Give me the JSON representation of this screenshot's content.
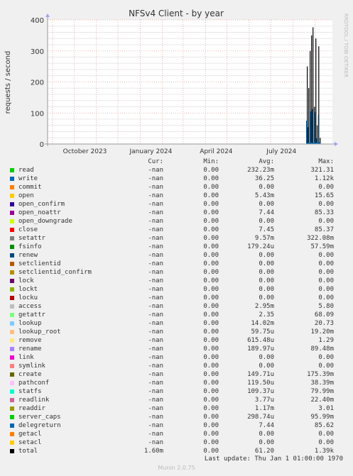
{
  "chart_data": {
    "type": "line",
    "title": "NFSv4 Client - by year",
    "ylabel": "requests / second",
    "side_label": "RRDTOOL / TOBI OETIKER",
    "ylim": [
      0,
      400
    ],
    "yticks": [
      0,
      100,
      200,
      300,
      400
    ],
    "xticks": [
      "October 2023",
      "January 2024",
      "April 2024",
      "July 2024"
    ],
    "grid": true,
    "spikes": {
      "x": [
        "2024-08-21",
        "2024-08-23",
        "2024-08-25",
        "2024-08-27",
        "2024-08-29",
        "2024-08-31",
        "2024-09-02",
        "2024-09-04",
        "2024-09-06",
        "2024-09-08"
      ],
      "total": [
        250,
        180,
        300,
        350,
        376,
        120,
        340,
        60,
        315,
        20
      ]
    },
    "colors": {
      "background": "#f0f0f0",
      "plot_bg": "#ffffff",
      "grid_major": "#e0a0a0",
      "grid_minor": "#e8e8e8",
      "axis": "#999999",
      "total": "#000000"
    }
  },
  "legend": {
    "headers": {
      "cur": "Cur:",
      "min": "Min:",
      "avg": "Avg:",
      "max": "Max:"
    },
    "rows": [
      {
        "name": "read",
        "color": "#00cc00",
        "cur": "-nan",
        "min": "0.00",
        "avg": "232.23m",
        "max": "321.31"
      },
      {
        "name": "write",
        "color": "#0066b3",
        "cur": "-nan",
        "min": "0.00",
        "avg": "36.25",
        "max": "1.12k"
      },
      {
        "name": "commit",
        "color": "#ff8000",
        "cur": "-nan",
        "min": "0.00",
        "avg": "0.00",
        "max": "0.00"
      },
      {
        "name": "open",
        "color": "#ffcc00",
        "cur": "-nan",
        "min": "0.00",
        "avg": "5.43m",
        "max": "15.65"
      },
      {
        "name": "open_confirm",
        "color": "#330099",
        "cur": "-nan",
        "min": "0.00",
        "avg": "0.00",
        "max": "0.00"
      },
      {
        "name": "open_noattr",
        "color": "#990099",
        "cur": "-nan",
        "min": "0.00",
        "avg": "7.44",
        "max": "85.33"
      },
      {
        "name": "open_downgrade",
        "color": "#ccff00",
        "cur": "-nan",
        "min": "0.00",
        "avg": "0.00",
        "max": "0.00"
      },
      {
        "name": "close",
        "color": "#ff0000",
        "cur": "-nan",
        "min": "0.00",
        "avg": "7.45",
        "max": "85.37"
      },
      {
        "name": "setattr",
        "color": "#808080",
        "cur": "-nan",
        "min": "0.00",
        "avg": "9.57m",
        "max": "322.08m"
      },
      {
        "name": "fsinfo",
        "color": "#008f00",
        "cur": "-nan",
        "min": "0.00",
        "avg": "179.24u",
        "max": "57.59m"
      },
      {
        "name": "renew",
        "color": "#00487d",
        "cur": "-nan",
        "min": "0.00",
        "avg": "0.00",
        "max": "0.00"
      },
      {
        "name": "setclientid",
        "color": "#b35a00",
        "cur": "-nan",
        "min": "0.00",
        "avg": "0.00",
        "max": "0.00"
      },
      {
        "name": "setclientid_confirm",
        "color": "#b38f00",
        "cur": "-nan",
        "min": "0.00",
        "avg": "0.00",
        "max": "0.00"
      },
      {
        "name": "lock",
        "color": "#6b006b",
        "cur": "-nan",
        "min": "0.00",
        "avg": "0.00",
        "max": "0.00"
      },
      {
        "name": "lockt",
        "color": "#8fb300",
        "cur": "-nan",
        "min": "0.00",
        "avg": "0.00",
        "max": "0.00"
      },
      {
        "name": "locku",
        "color": "#b30000",
        "cur": "-nan",
        "min": "0.00",
        "avg": "0.00",
        "max": "0.00"
      },
      {
        "name": "access",
        "color": "#bebebe",
        "cur": "-nan",
        "min": "0.00",
        "avg": "2.95m",
        "max": "5.80"
      },
      {
        "name": "getattr",
        "color": "#80ff80",
        "cur": "-nan",
        "min": "0.00",
        "avg": "2.35",
        "max": "68.09"
      },
      {
        "name": "lookup",
        "color": "#80c9ff",
        "cur": "-nan",
        "min": "0.00",
        "avg": "14.02m",
        "max": "20.73"
      },
      {
        "name": "lookup_root",
        "color": "#ffc080",
        "cur": "-nan",
        "min": "0.00",
        "avg": "59.75u",
        "max": "19.20m"
      },
      {
        "name": "remove",
        "color": "#ffe680",
        "cur": "-nan",
        "min": "0.00",
        "avg": "615.48u",
        "max": "1.29"
      },
      {
        "name": "rename",
        "color": "#aa80ff",
        "cur": "-nan",
        "min": "0.00",
        "avg": "189.97u",
        "max": "89.48m"
      },
      {
        "name": "link",
        "color": "#ee00cc",
        "cur": "-nan",
        "min": "0.00",
        "avg": "0.00",
        "max": "0.00"
      },
      {
        "name": "symlink",
        "color": "#ff8080",
        "cur": "-nan",
        "min": "0.00",
        "avg": "0.00",
        "max": "0.00"
      },
      {
        "name": "create",
        "color": "#666600",
        "cur": "-nan",
        "min": "0.00",
        "avg": "149.71u",
        "max": "175.39m"
      },
      {
        "name": "pathconf",
        "color": "#ffbfff",
        "cur": "-nan",
        "min": "0.00",
        "avg": "119.50u",
        "max": "38.39m"
      },
      {
        "name": "statfs",
        "color": "#00ffcc",
        "cur": "-nan",
        "min": "0.00",
        "avg": "109.37u",
        "max": "79.99m"
      },
      {
        "name": "readlink",
        "color": "#cc6699",
        "cur": "-nan",
        "min": "0.00",
        "avg": "3.77u",
        "max": "22.40m"
      },
      {
        "name": "readdir",
        "color": "#999900",
        "cur": "-nan",
        "min": "0.00",
        "avg": "1.17m",
        "max": "3.01"
      },
      {
        "name": "server_caps",
        "color": "#00cc00",
        "cur": "-nan",
        "min": "0.00",
        "avg": "298.74u",
        "max": "95.99m"
      },
      {
        "name": "delegreturn",
        "color": "#0066b3",
        "cur": "-nan",
        "min": "0.00",
        "avg": "7.44",
        "max": "85.62"
      },
      {
        "name": "getacl",
        "color": "#ff8000",
        "cur": "-nan",
        "min": "0.00",
        "avg": "0.00",
        "max": "0.00"
      },
      {
        "name": "setacl",
        "color": "#ffcc00",
        "cur": "-nan",
        "min": "0.00",
        "avg": "0.00",
        "max": "0.00"
      },
      {
        "name": "total",
        "color": "#000000",
        "cur": "1.60m",
        "min": "0.00",
        "avg": "61.20",
        "max": "1.39k"
      }
    ]
  },
  "footer": {
    "last_update": "Last update: Thu Jan  1 01:00:00 1970",
    "version": "Munin 2.0.75"
  }
}
